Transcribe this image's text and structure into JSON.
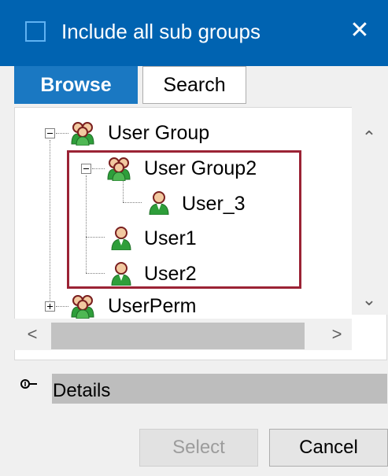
{
  "dialog": {
    "title": "Include all sub groups",
    "close_symbol": "✕",
    "checkbox_checked": false
  },
  "tabs": [
    {
      "label": "Browse",
      "active": true
    },
    {
      "label": "Search",
      "active": false
    }
  ],
  "tree": {
    "nodes": [
      {
        "label": "User Group",
        "type": "group",
        "expander": "minus",
        "level": 0
      },
      {
        "label": "User Group2",
        "type": "group",
        "expander": "minus",
        "level": 1
      },
      {
        "label": "User_3",
        "type": "user",
        "expander": null,
        "level": 2
      },
      {
        "label": "User1",
        "type": "user",
        "expander": null,
        "level": 1
      },
      {
        "label": "User2",
        "type": "user",
        "expander": null,
        "level": 1
      },
      {
        "label": "UserPerm",
        "type": "group",
        "expander": "plus",
        "level": 0
      }
    ],
    "highlight_color": "#9b2335"
  },
  "scrollbar": {
    "up_arrow": "⌃",
    "down_arrow": "⌄",
    "left_arrow": "<",
    "right_arrow": ">"
  },
  "details": {
    "label": "Details",
    "icon": "collapse-key-icon"
  },
  "buttons": {
    "select_label": "Select",
    "select_enabled": false,
    "cancel_label": "Cancel"
  },
  "colors": {
    "titlebar": "#0063b1",
    "tab_active": "#1a78c2",
    "user_icon_green": "#2e9e3a",
    "group_icon_red": "#c0392b"
  }
}
